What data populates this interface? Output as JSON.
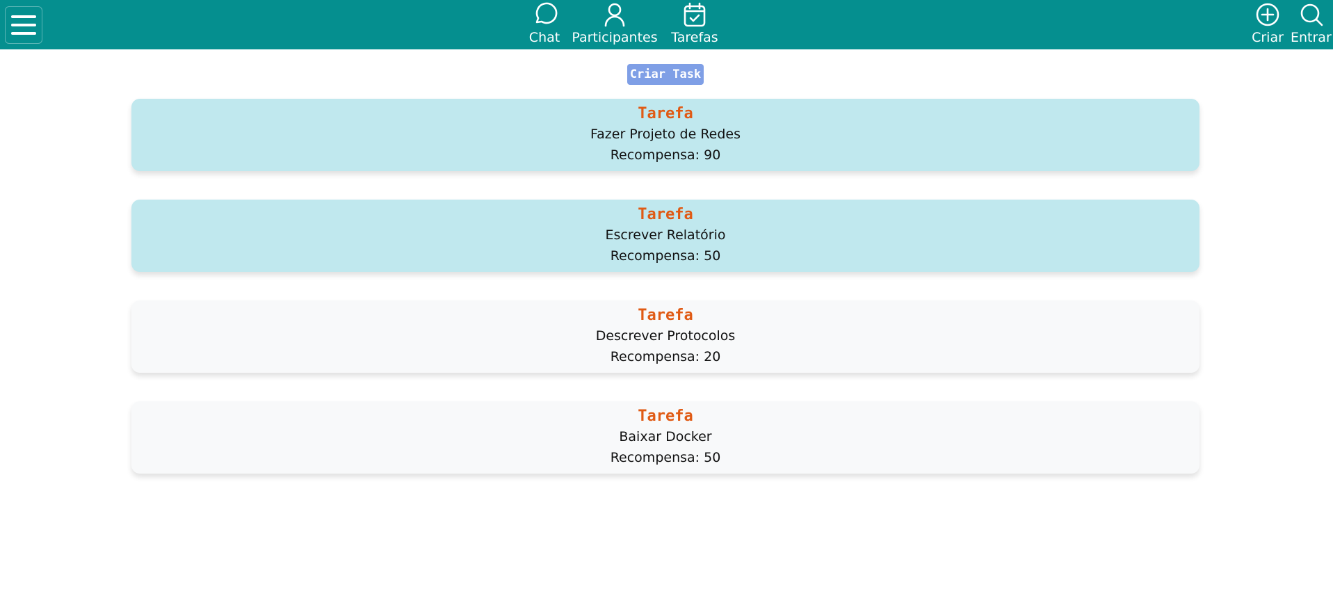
{
  "colors": {
    "navbar_bg": "#058f8f",
    "accent_button": "#7f9fe6",
    "task_heading": "#e05a14",
    "card_highlight": "#c0e8ee",
    "card_plain": "#f8f9fa"
  },
  "navbar": {
    "menu_icon": "hamburger-menu-icon",
    "center_items": [
      {
        "label": "Chat",
        "icon": "chat-bubble-icon"
      },
      {
        "label": "Participantes",
        "icon": "person-icon"
      },
      {
        "label": "Tarefas",
        "icon": "calendar-check-icon"
      }
    ],
    "right_items": [
      {
        "label": "Criar",
        "icon": "plus-circle-icon"
      },
      {
        "label": "Entrar",
        "icon": "search-icon"
      }
    ]
  },
  "main": {
    "create_button_label": "Criar Task",
    "tasks": [
      {
        "heading": "Tarefa",
        "title": "Fazer Projeto de Redes",
        "reward_label": "Recompensa:",
        "reward_value": "90",
        "highlighted": true
      },
      {
        "heading": "Tarefa",
        "title": "Escrever Relatório",
        "reward_label": "Recompensa:",
        "reward_value": "50",
        "highlighted": true
      },
      {
        "heading": "Tarefa",
        "title": "Descrever Protocolos",
        "reward_label": "Recompensa:",
        "reward_value": "20",
        "highlighted": false
      },
      {
        "heading": "Tarefa",
        "title": "Baixar Docker",
        "reward_label": "Recompensa:",
        "reward_value": "50",
        "highlighted": false
      }
    ]
  }
}
